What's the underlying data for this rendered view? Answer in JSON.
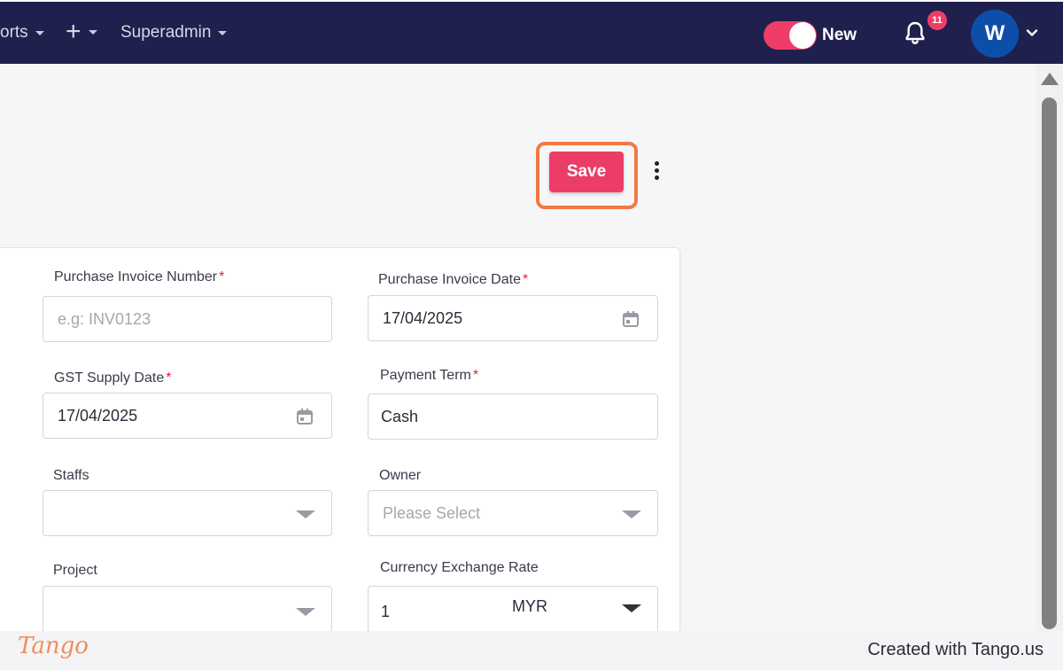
{
  "nav": {
    "reports_label": "orts",
    "superadmin_label": "Superadmin",
    "toggle_label": "New",
    "notification_count": "11",
    "avatar_initial": "W"
  },
  "toolbar": {
    "save_label": "Save"
  },
  "form": {
    "purchase_invoice_number": {
      "label": "Purchase Invoice Number",
      "required": "*",
      "placeholder": "e.g: INV0123"
    },
    "purchase_invoice_date": {
      "label": "Purchase Invoice Date",
      "required": "*",
      "value": "17/04/2025"
    },
    "gst_supply_date": {
      "label": "GST Supply Date",
      "required": "*",
      "value": "17/04/2025"
    },
    "payment_term": {
      "label": "Payment Term",
      "required": "*",
      "value": "Cash"
    },
    "staffs": {
      "label": "Staffs",
      "value": ""
    },
    "owner": {
      "label": "Owner",
      "placeholder": "Please Select"
    },
    "project": {
      "label": "Project",
      "value": ""
    },
    "currency_exchange_rate": {
      "label": "Currency Exchange Rate",
      "value": "1",
      "currency": "MYR"
    }
  },
  "footer": {
    "logo_text": "Tango",
    "credit_text": "Created with Tango.us"
  },
  "colors": {
    "nav_bg": "#20204e",
    "accent": "#ec3d68",
    "highlight": "#f07a42",
    "avatar_bg": "#0d4fa8"
  }
}
